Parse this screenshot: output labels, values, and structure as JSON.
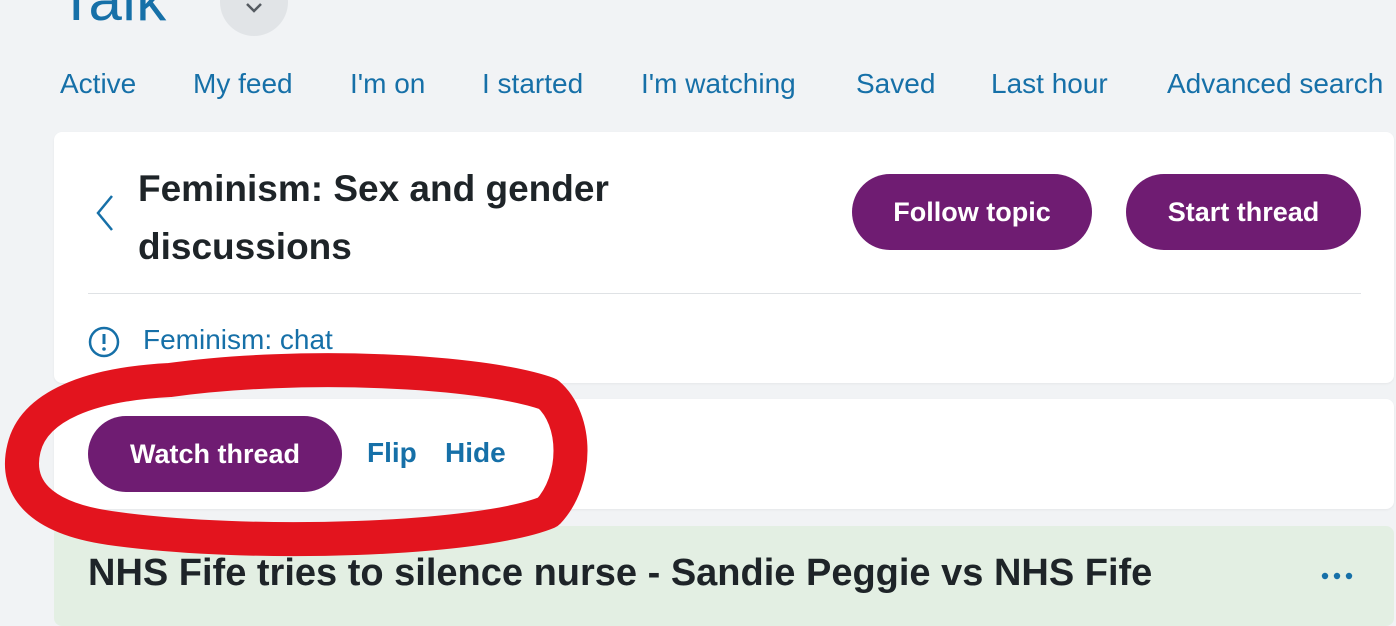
{
  "app": {
    "title": "Talk"
  },
  "nav": {
    "items": [
      {
        "label": "Active"
      },
      {
        "label": "My feed"
      },
      {
        "label": "I'm on"
      },
      {
        "label": "I started"
      },
      {
        "label": "I'm watching"
      },
      {
        "label": "Saved"
      },
      {
        "label": "Last hour"
      },
      {
        "label": "Advanced search"
      }
    ]
  },
  "topic": {
    "title": "Feminism: Sex and gender discussions",
    "follow_label": "Follow topic",
    "start_label": "Start thread",
    "related_link": "Feminism: chat"
  },
  "thread_tools": {
    "watch_label": "Watch thread",
    "flip_label": "Flip",
    "hide_label": "Hide"
  },
  "thread": {
    "title": "NHS Fife tries to silence nurse - Sandie Peggie vs NHS Fife"
  },
  "colors": {
    "link": "#1670a8",
    "button": "#6f1c72",
    "thread_bg": "#e3efe3",
    "annotation": "#e3141e"
  },
  "icons": {
    "title_toggle": "chevron-down-icon",
    "back": "chevron-left-icon",
    "info": "info-circle-icon",
    "more": "more-dots-icon"
  }
}
